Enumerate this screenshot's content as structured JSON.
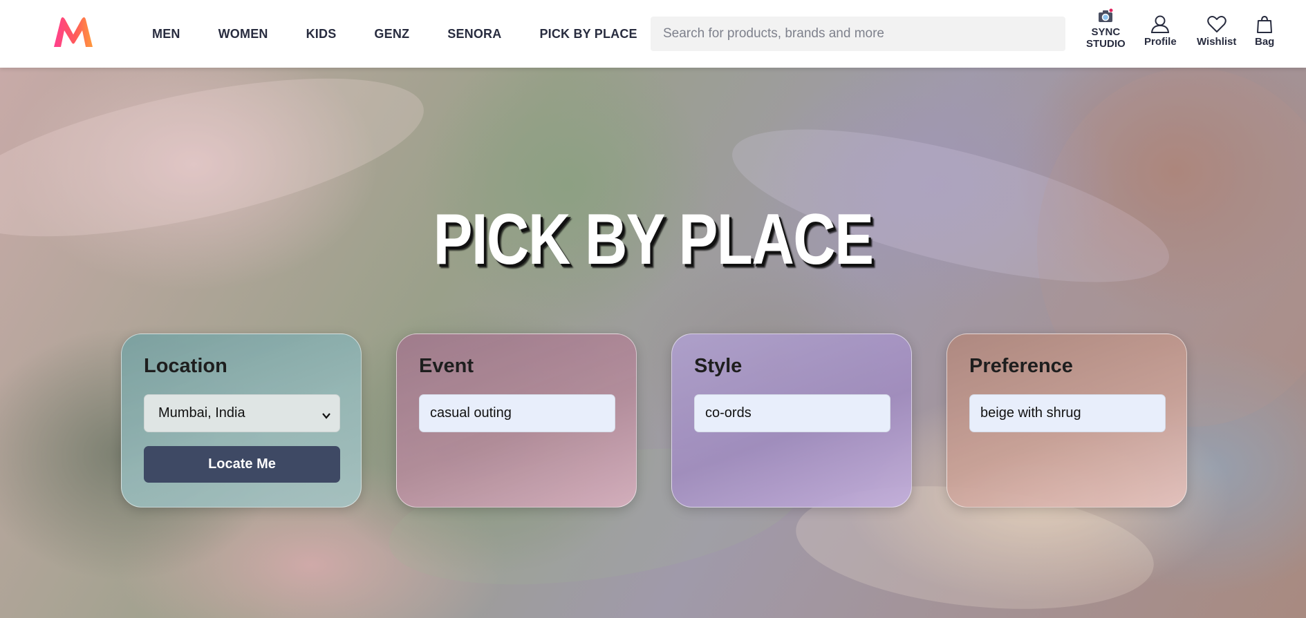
{
  "brand": {
    "name": "Myntra",
    "logo_icon": "myntra-logo-icon"
  },
  "nav": {
    "items": [
      {
        "label": "MEN"
      },
      {
        "label": "WOMEN"
      },
      {
        "label": "KIDS"
      },
      {
        "label": "GENZ"
      },
      {
        "label": "SENORA"
      },
      {
        "label": "PICK BY PLACE"
      }
    ]
  },
  "search": {
    "placeholder": "Search for products, brands and more",
    "value": ""
  },
  "actions": {
    "sync_studio": {
      "line1": "SYNC",
      "line2": "STUDIO",
      "icon": "camera-icon"
    },
    "profile": {
      "label": "Profile",
      "icon": "user-icon"
    },
    "wishlist": {
      "label": "Wishlist",
      "icon": "heart-icon"
    },
    "bag": {
      "label": "Bag",
      "icon": "bag-icon"
    }
  },
  "hero": {
    "title": "PICK BY PLACE"
  },
  "cards": {
    "location": {
      "title": "Location",
      "selected": "Mumbai, India",
      "button": "Locate Me"
    },
    "event": {
      "title": "Event",
      "value": "casual outing"
    },
    "style": {
      "title": "Style",
      "value": "co-ords"
    },
    "preference": {
      "title": "Preference",
      "value": "beige with shrug"
    }
  },
  "colors": {
    "accent_button": "#3e4964",
    "nav_text": "#282c3f",
    "logo_pink": "#ff3f6c",
    "logo_orange": "#ff9a3c"
  }
}
